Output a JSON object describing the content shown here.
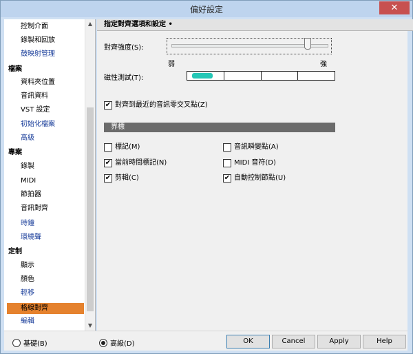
{
  "window": {
    "title": "偏好設定",
    "close_glyph": "✕"
  },
  "sidebar": {
    "items": [
      {
        "label": "控制介面",
        "kind": "plain"
      },
      {
        "label": "錄製和回放",
        "kind": "plain"
      },
      {
        "label": "鼓映射管理",
        "kind": "link"
      },
      {
        "label": "檔案",
        "kind": "cat"
      },
      {
        "label": "資料夾位置",
        "kind": "plain"
      },
      {
        "label": "音訊資料",
        "kind": "plain"
      },
      {
        "label": "VST 設定",
        "kind": "plain"
      },
      {
        "label": "初始化檔案",
        "kind": "link"
      },
      {
        "label": "高級",
        "kind": "link"
      },
      {
        "label": "專案",
        "kind": "cat"
      },
      {
        "label": "錄製",
        "kind": "plain"
      },
      {
        "label": "MIDI",
        "kind": "plain"
      },
      {
        "label": "節拍器",
        "kind": "plain"
      },
      {
        "label": "音訊對齊",
        "kind": "plain"
      },
      {
        "label": "時鐘",
        "kind": "link"
      },
      {
        "label": "環繞聲",
        "kind": "link"
      },
      {
        "label": "定制",
        "kind": "cat"
      },
      {
        "label": "顯示",
        "kind": "plain"
      },
      {
        "label": "顏色",
        "kind": "plain"
      },
      {
        "label": "輕移",
        "kind": "link"
      },
      {
        "label": "格線對齊",
        "kind": "selected"
      },
      {
        "label": "編輯",
        "kind": "link"
      }
    ],
    "scroll_up": "▲",
    "scroll_down": "▼"
  },
  "panel": {
    "header": "指定對齊選項和設定 •",
    "strength_label": "對齊強度(S):",
    "strength_min": "弱",
    "strength_max": "強",
    "strength_value": 0.9,
    "magnet_label": "磁性測試(T):",
    "snap_nearest": {
      "label": "對齊到最近的音訊零交叉點(Z)",
      "checked": true
    },
    "section_title": "界標",
    "landmarks": [
      {
        "label": "標記(M)",
        "checked": false
      },
      {
        "label": "當前時間標記(N)",
        "checked": true
      },
      {
        "label": "剪輯(C)",
        "checked": true
      },
      {
        "label": "音訊瞬變點(A)",
        "checked": false
      },
      {
        "label": "MIDI 音符(D)",
        "checked": false
      },
      {
        "label": "自動控制節點(U)",
        "checked": true
      }
    ]
  },
  "footer": {
    "basic_label": "基礎(B)",
    "advanced_label": "高級(D)",
    "advanced_selected": true,
    "ok": "OK",
    "cancel": "Cancel",
    "apply": "Apply",
    "help": "Help"
  },
  "colors": {
    "selected_item": "#e5822e",
    "magnet_fill": "#25c7b6",
    "link_text": "#1b3f9b"
  }
}
